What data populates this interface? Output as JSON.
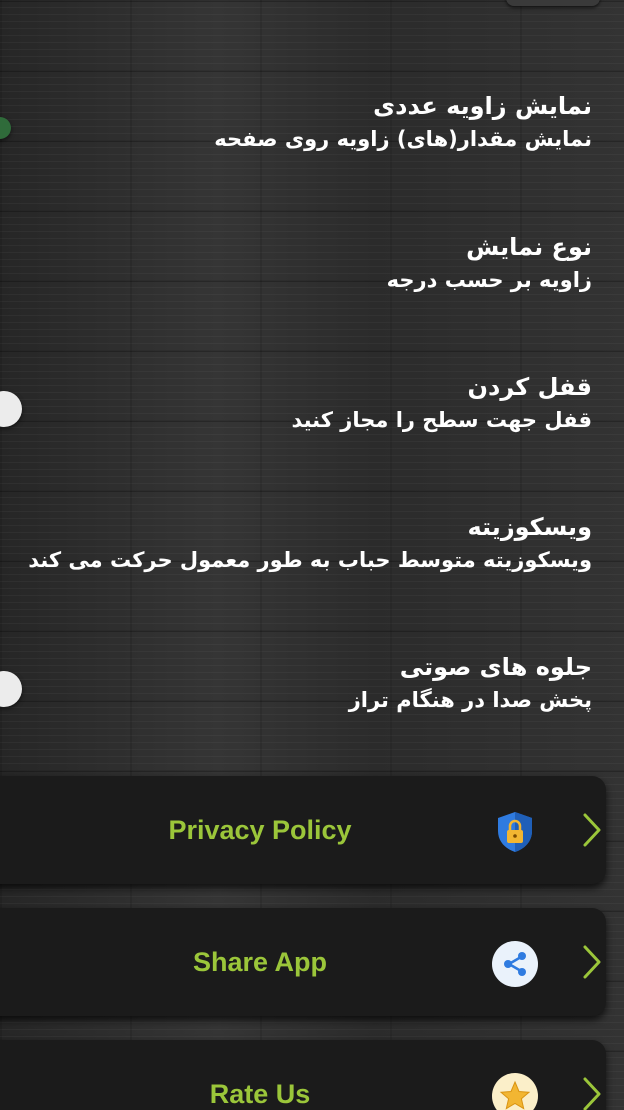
{
  "settings": [
    {
      "title": "نمایش زاویه عددی",
      "subtitle": "نمایش مقدار(های) زاویه روی صفحه",
      "toggle_on": true
    },
    {
      "title": "نوع نمایش",
      "subtitle": "زاویه بر حسب درجه"
    },
    {
      "title": "قفل کردن",
      "subtitle": "قفل جهت سطح را مجاز کنید",
      "toggle_on": false
    },
    {
      "title": "ویسکوزیته",
      "subtitle": "ویسکوزیته متوسط حباب به طور معمول حرکت می کند"
    },
    {
      "title": "جلوه های صوتی",
      "subtitle": "پخش صدا در هنگام تراز",
      "toggle_on": false
    }
  ],
  "menu": [
    {
      "label": "Privacy Policy",
      "icon": "shield-lock-icon"
    },
    {
      "label": "Share App",
      "icon": "share-icon"
    },
    {
      "label": "Rate Us",
      "icon": "star-icon"
    }
  ],
  "colors": {
    "accent": "#9bc63a",
    "card_bg": "#1b1b1b",
    "toggle_on": "#2f6b3a",
    "toggle_off": "#ececec"
  }
}
